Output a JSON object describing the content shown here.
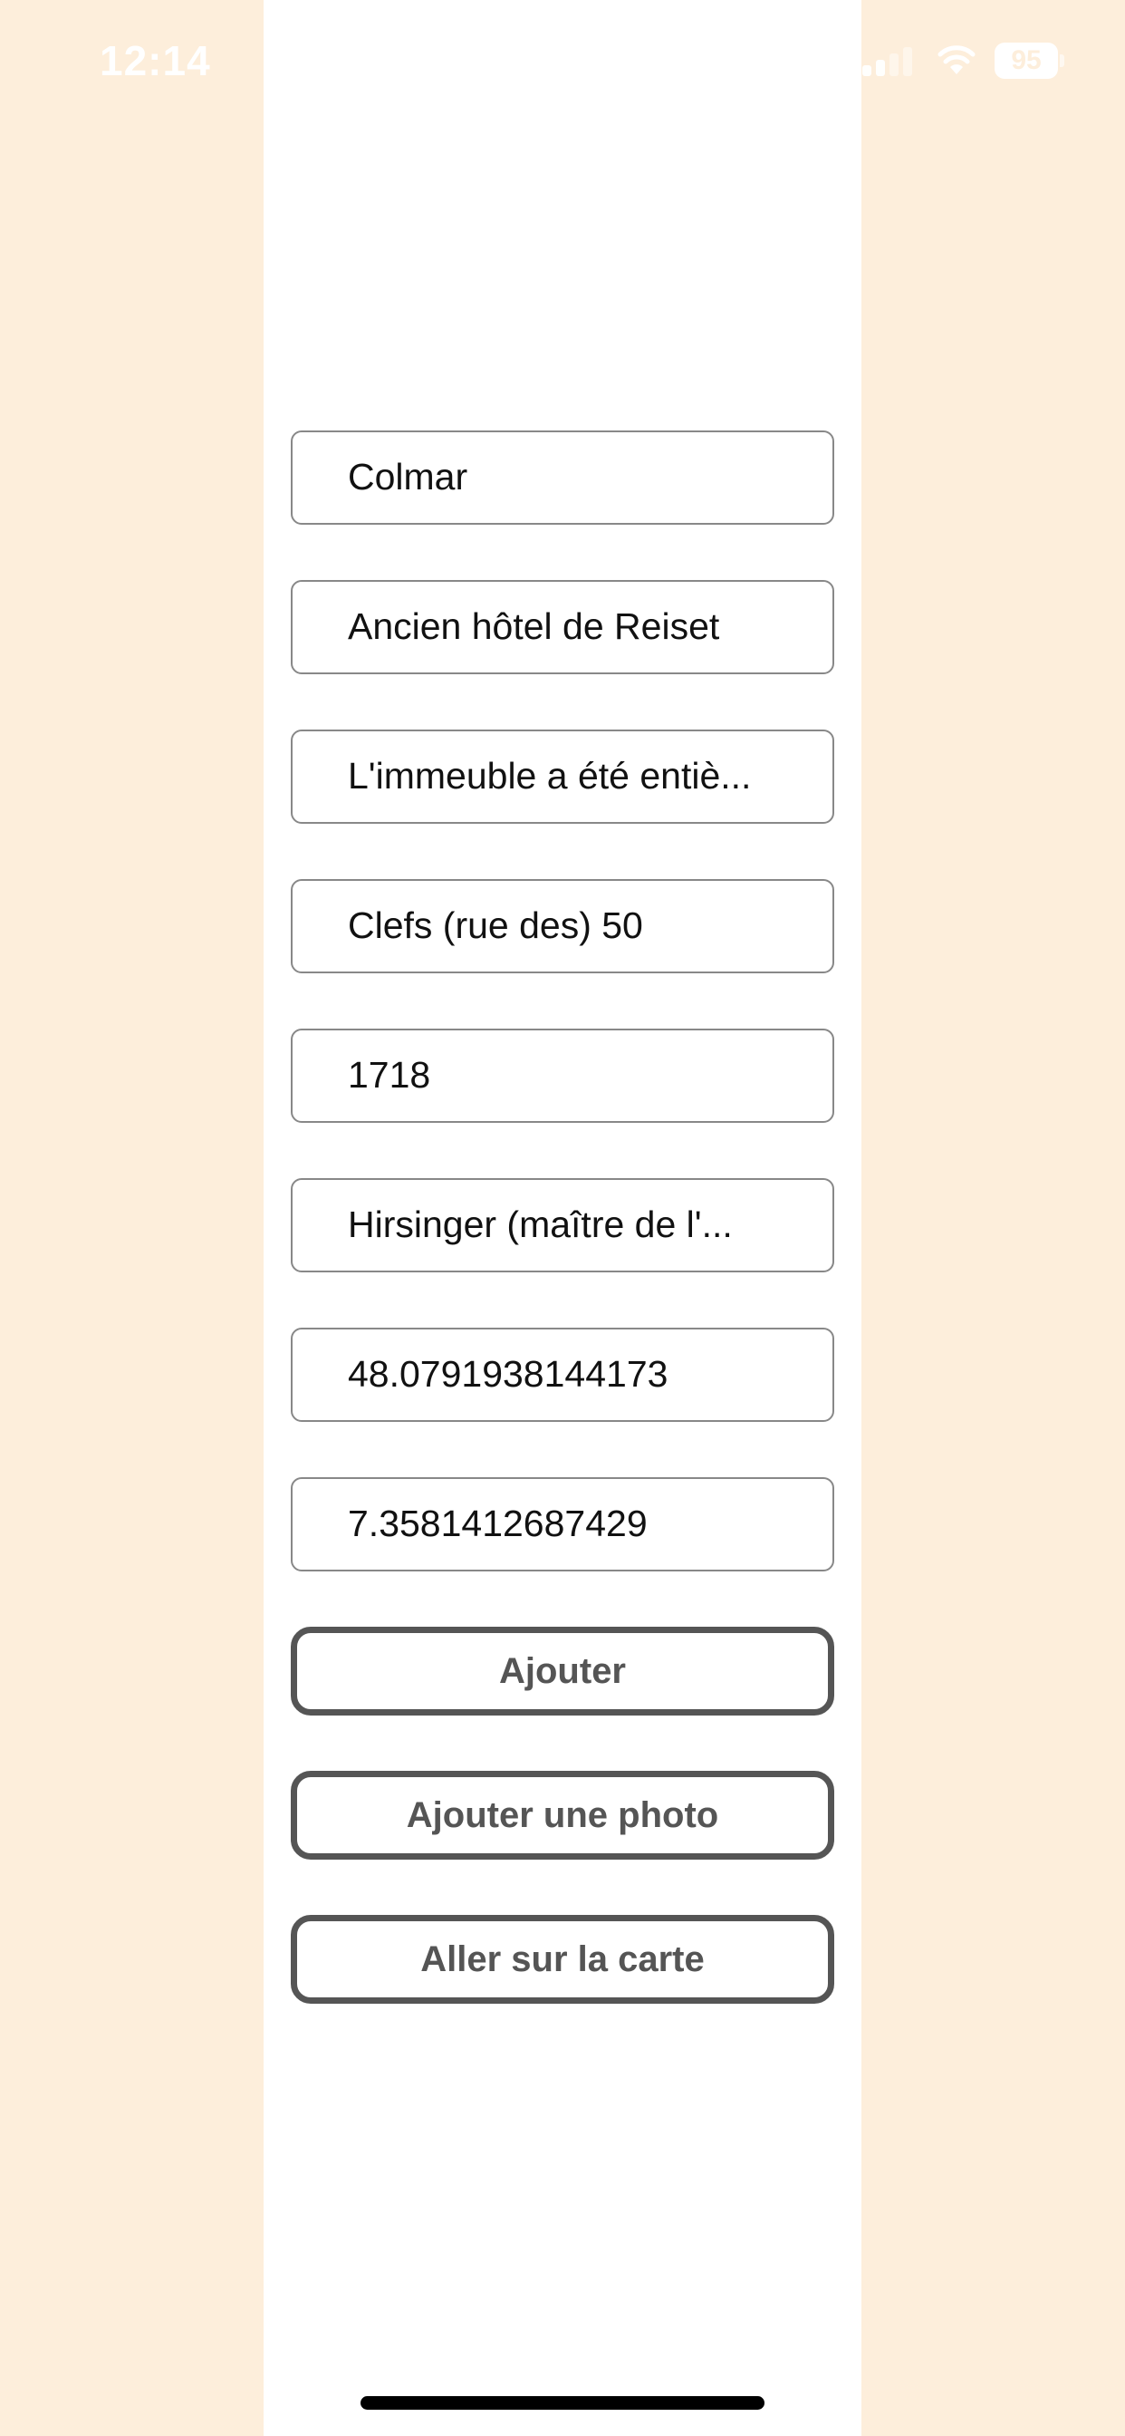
{
  "status_bar": {
    "time": "12:14",
    "battery": "95"
  },
  "form": {
    "fields": [
      "Colmar",
      "Ancien hôtel de Reiset",
      "L'immeuble a été entiè...",
      "Clefs (rue des) 50",
      "1718",
      "Hirsinger (maître de l'...",
      "48.0791938144173",
      "7.3581412687429"
    ]
  },
  "buttons": {
    "add": "Ajouter",
    "add_photo": "Ajouter une photo",
    "go_map": "Aller sur la carte"
  },
  "colors": {
    "background": "#fdeedb",
    "panel": "#ffffff",
    "border": "#888888",
    "button_text": "#555555"
  }
}
